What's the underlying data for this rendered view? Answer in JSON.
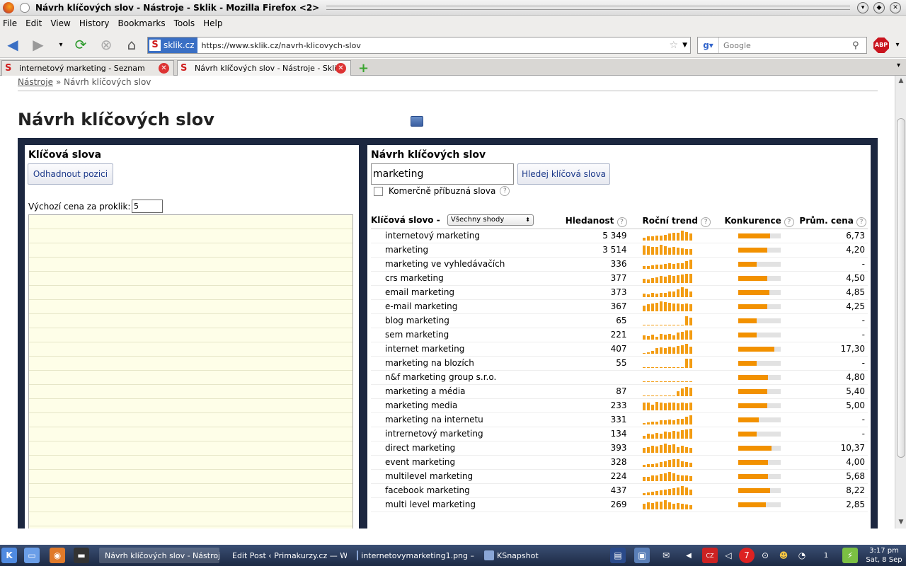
{
  "window": {
    "title": "Návrh klíčových slov - Nástroje - Sklik - Mozilla Firefox <2>"
  },
  "menu": [
    "File",
    "Edit",
    "View",
    "History",
    "Bookmarks",
    "Tools",
    "Help"
  ],
  "navbar": {
    "site_label": "sklik.cz",
    "url": "https://www.sklik.cz/navrh-klicovych-slov",
    "search_placeholder": "Google",
    "abp_label": "ABP"
  },
  "tabs": [
    {
      "label": "internetový marketing - Seznam",
      "active": false
    },
    {
      "label": "Návrh klíčových slov - Nástroje - Sklik",
      "active": true
    }
  ],
  "page": {
    "breadcrumb_link": "Nástroje",
    "breadcrumb_sep": "»",
    "breadcrumb_current": "Návrh klíčových slov",
    "title": "Návrh klíčových slov",
    "left": {
      "title": "Klíčová slova",
      "estimate_button": "Odhadnout pozici",
      "price_label": "Výchozí cena za proklik:",
      "price_value": "5"
    },
    "right": {
      "title": "Návrh klíčových slov",
      "keyword_value": "marketing",
      "search_button": "Hledej klíčová slova",
      "commercial_label": "Komerčně příbuzná slova",
      "help": "?",
      "columns": {
        "keyword": "Klíčová slovo",
        "match_sep": "-",
        "match_select": "Všechny shody",
        "searches": "Hledanost",
        "trend": "Roční trend",
        "competition": "Konkurence",
        "avg_price": "Prům. cena"
      },
      "rows": [
        {
          "keyword": "internetový marketing",
          "searches": "5 349",
          "competition": 0.75,
          "price": "6,73",
          "trend": [
            0.3,
            0.4,
            0.45,
            0.5,
            0.5,
            0.6,
            0.7,
            0.75,
            0.8,
            1.0,
            0.85,
            0.7
          ]
        },
        {
          "keyword": "marketing",
          "searches": "3 514",
          "competition": 0.68,
          "price": "4,20",
          "trend": [
            0.9,
            0.85,
            0.75,
            0.8,
            1.0,
            0.85,
            0.7,
            0.75,
            0.7,
            0.65,
            0.6,
            0.55
          ]
        },
        {
          "keyword": "marketing ve vyhledávačích",
          "searches": "336",
          "competition": 0.42,
          "price": "-",
          "trend": [
            0.3,
            0.25,
            0.35,
            0.4,
            0.45,
            0.5,
            0.55,
            0.5,
            0.6,
            0.55,
            0.75,
            0.95
          ]
        },
        {
          "keyword": "crs marketing",
          "searches": "377",
          "competition": 0.68,
          "price": "4,50",
          "trend": [
            0.45,
            0.35,
            0.5,
            0.6,
            0.7,
            0.65,
            0.75,
            0.7,
            0.8,
            0.85,
            0.9,
            0.95
          ]
        },
        {
          "keyword": "email marketing",
          "searches": "373",
          "competition": 0.72,
          "price": "4,85",
          "trend": [
            0.35,
            0.3,
            0.4,
            0.35,
            0.45,
            0.4,
            0.55,
            0.6,
            0.75,
            1.0,
            0.85,
            0.6
          ]
        },
        {
          "keyword": "e-mail marketing",
          "searches": "367",
          "competition": 0.68,
          "price": "4,25",
          "trend": [
            0.6,
            0.7,
            0.8,
            0.85,
            1.0,
            0.9,
            0.85,
            0.75,
            0.8,
            0.7,
            0.75,
            0.7
          ]
        },
        {
          "keyword": "blog marketing",
          "searches": "65",
          "competition": 0.42,
          "price": "-",
          "trend": [
            0,
            0,
            0,
            0,
            0,
            0,
            0,
            0,
            0,
            0.1,
            0.95,
            0.8
          ]
        },
        {
          "keyword": "sem marketing",
          "searches": "221",
          "competition": 0.42,
          "price": "-",
          "trend": [
            0.4,
            0.35,
            0.5,
            0.3,
            0.55,
            0.5,
            0.6,
            0.45,
            0.7,
            0.8,
            0.9,
            0.95
          ]
        },
        {
          "keyword": "internet marketing",
          "searches": "407",
          "competition": 0.84,
          "price": "17,30",
          "trend": [
            0.1,
            0.15,
            0.3,
            0.6,
            0.65,
            0.6,
            0.7,
            0.65,
            0.75,
            0.85,
            1.0,
            0.7
          ]
        },
        {
          "keyword": "marketing na blozích",
          "searches": "55",
          "competition": 0.42,
          "price": "-",
          "trend": [
            0,
            0,
            0,
            0,
            0,
            0,
            0,
            0,
            0,
            0.1,
            0.9,
            0.9
          ]
        },
        {
          "keyword": "n&f marketing group s.r.o.",
          "searches": "",
          "competition": 0.7,
          "price": "4,80",
          "trend": [
            0.05,
            0.05,
            0.05,
            0.05,
            0.05,
            0.05,
            0.05,
            0.05,
            0.05,
            0.05,
            0.05,
            0.05
          ]
        },
        {
          "keyword": "marketing a média",
          "searches": "87",
          "competition": 0.68,
          "price": "5,40",
          "trend": [
            0.05,
            0.05,
            0.05,
            0.05,
            0.05,
            0.05,
            0.1,
            0.1,
            0.5,
            0.8,
            0.9,
            0.85
          ]
        },
        {
          "keyword": "marketing media",
          "searches": "233",
          "competition": 0.68,
          "price": "5,00",
          "trend": [
            0.8,
            0.75,
            0.6,
            0.85,
            0.8,
            0.7,
            0.75,
            0.8,
            0.7,
            0.75,
            0.7,
            0.75
          ]
        },
        {
          "keyword": "marketing na internetu",
          "searches": "331",
          "competition": 0.48,
          "price": "-",
          "trend": [
            0.15,
            0.2,
            0.3,
            0.25,
            0.4,
            0.45,
            0.5,
            0.4,
            0.6,
            0.55,
            0.8,
            0.95
          ]
        },
        {
          "keyword": "intrernetový marketing",
          "searches": "134",
          "competition": 0.42,
          "price": "-",
          "trend": [
            0.3,
            0.5,
            0.45,
            0.6,
            0.5,
            0.7,
            0.65,
            0.75,
            0.7,
            0.85,
            0.95,
            1.0
          ]
        },
        {
          "keyword": "direct marketing",
          "searches": "393",
          "competition": 0.78,
          "price": "10,37",
          "trend": [
            0.5,
            0.6,
            0.7,
            0.65,
            0.8,
            0.9,
            0.75,
            0.85,
            0.6,
            0.7,
            0.55,
            0.5
          ]
        },
        {
          "keyword": "event marketing",
          "searches": "328",
          "competition": 0.7,
          "price": "4,00",
          "trend": [
            0.2,
            0.25,
            0.3,
            0.35,
            0.5,
            0.55,
            0.7,
            0.8,
            0.75,
            0.6,
            0.5,
            0.4
          ]
        },
        {
          "keyword": "multilevel marketing",
          "searches": "224",
          "competition": 0.7,
          "price": "5,68",
          "trend": [
            0.4,
            0.45,
            0.6,
            0.55,
            0.7,
            0.75,
            0.9,
            0.8,
            0.65,
            0.55,
            0.6,
            0.5
          ]
        },
        {
          "keyword": "facebook marketing",
          "searches": "437",
          "competition": 0.74,
          "price": "8,22",
          "trend": [
            0.2,
            0.25,
            0.35,
            0.4,
            0.5,
            0.55,
            0.65,
            0.7,
            0.8,
            0.9,
            0.75,
            0.6
          ]
        },
        {
          "keyword": "multi level marketing",
          "searches": "269",
          "competition": 0.64,
          "price": "2,85",
          "trend": [
            0.6,
            0.7,
            0.65,
            0.8,
            0.75,
            0.9,
            0.7,
            0.6,
            0.65,
            0.55,
            0.5,
            0.45
          ]
        }
      ]
    }
  },
  "taskbar": {
    "tasks": [
      {
        "label": "Návrh klíčových slov - Nástroj",
        "active": true
      },
      {
        "label": "Edit Post ‹ Primakurzy.cz — W",
        "active": false
      },
      {
        "label": "internetovymarketing1.png –",
        "active": false
      },
      {
        "label": "KSnapshot",
        "active": false
      }
    ],
    "time": "3:17 pm",
    "date": "Sat, 8 Sep",
    "desktop_number": "1"
  },
  "colors": {
    "accent": "#f29100",
    "frame": "#1c2740",
    "link_blue": "#1d3a8a"
  }
}
